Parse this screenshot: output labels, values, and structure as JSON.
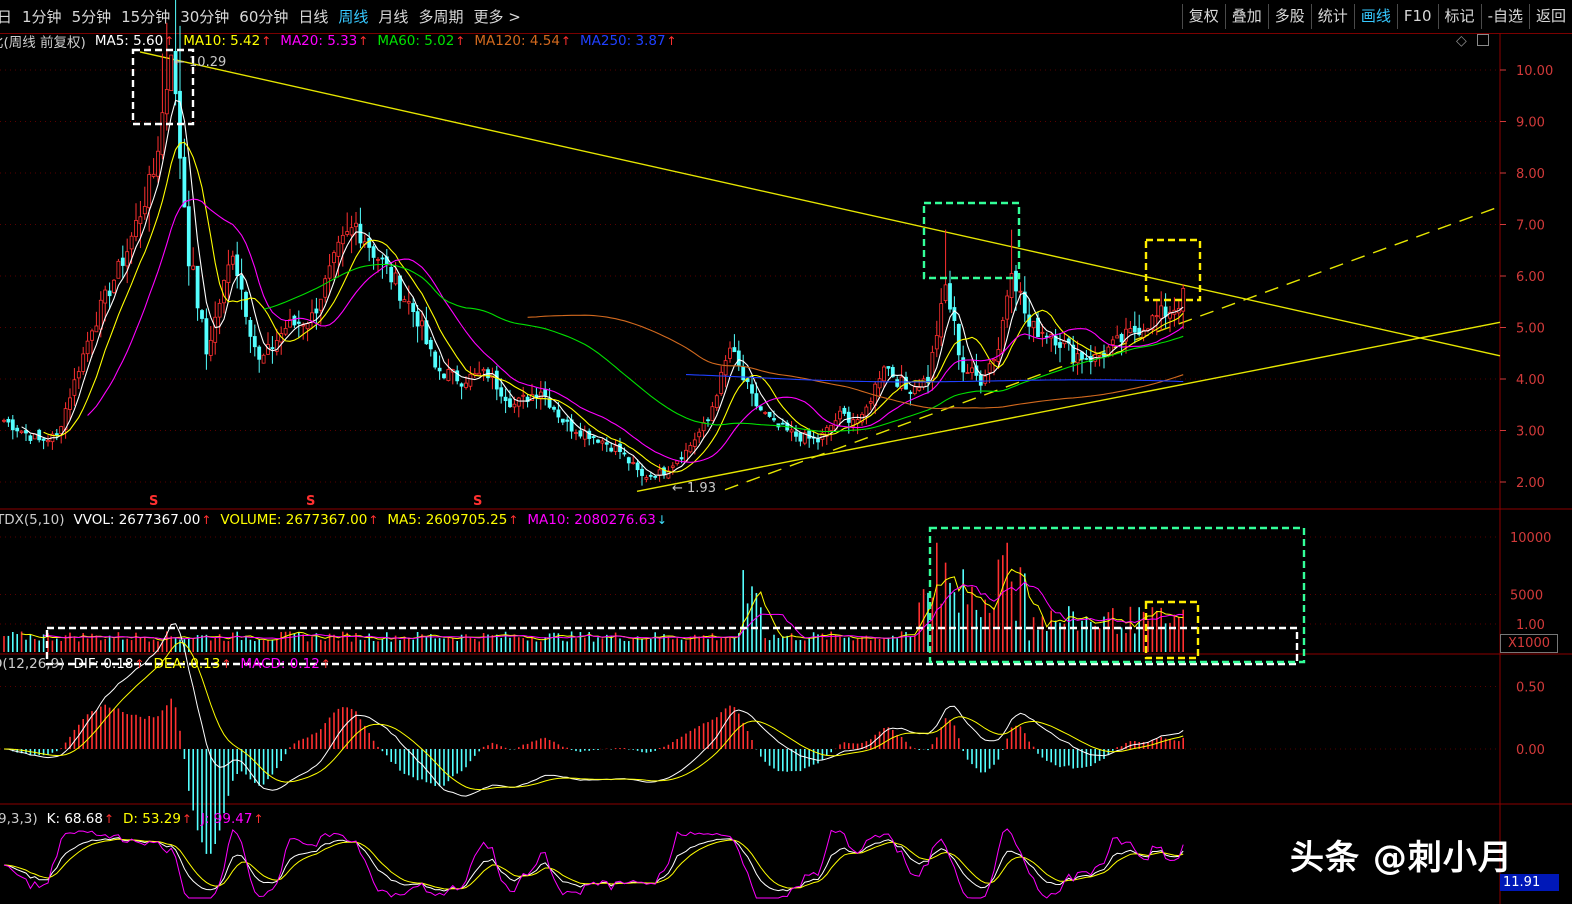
{
  "toolbar": {
    "left_items": [
      {
        "label": "日",
        "active": false
      },
      {
        "label": "1分钟",
        "active": false
      },
      {
        "label": "5分钟",
        "active": false
      },
      {
        "label": "15分钟",
        "active": false
      },
      {
        "label": "30分钟",
        "active": false
      },
      {
        "label": "60分钟",
        "active": false
      },
      {
        "label": "日线",
        "active": false
      },
      {
        "label": "周线",
        "active": true
      },
      {
        "label": "月线",
        "active": false
      },
      {
        "label": "多周期",
        "active": false
      },
      {
        "label": "更多 >",
        "active": false
      }
    ],
    "right_items": [
      {
        "label": "复权",
        "active": false
      },
      {
        "label": "叠加",
        "active": false
      },
      {
        "label": "多股",
        "active": false
      },
      {
        "label": "统计",
        "active": false
      },
      {
        "label": "画线",
        "active": true
      },
      {
        "label": "F10",
        "active": false
      },
      {
        "label": "标记",
        "active": false
      },
      {
        "label": "-自选",
        "active": false
      },
      {
        "label": "返回",
        "active": false
      }
    ]
  },
  "price_legend": {
    "title": "比(周线 前复权)",
    "items": [
      {
        "label": "MA5: 5.60",
        "color": "#ffffff",
        "arrow": "↑",
        "arrow_color": "#ff3030"
      },
      {
        "label": "MA10: 5.42",
        "color": "#ffff00",
        "arrow": "↑",
        "arrow_color": "#ff3030"
      },
      {
        "label": "MA20: 5.33",
        "color": "#ff00ff",
        "arrow": "↑",
        "arrow_color": "#ff3030"
      },
      {
        "label": "MA60: 5.02",
        "color": "#00e000",
        "arrow": "↑",
        "arrow_color": "#ff3030"
      },
      {
        "label": "MA120: 4.54",
        "color": "#d2691e",
        "arrow": "↑",
        "arrow_color": "#ff3030"
      },
      {
        "label": "MA250: 3.87",
        "color": "#2040ff",
        "arrow": "↑",
        "arrow_color": "#ff3030"
      }
    ]
  },
  "volume_legend": {
    "items": [
      {
        "label": "TDX(5,10)",
        "color": "#cccccc",
        "arrow": "",
        "arrow_color": ""
      },
      {
        "label": "VVOL: 2677367.00",
        "color": "#ffffff",
        "arrow": "↑",
        "arrow_color": "#ff3030"
      },
      {
        "label": "VOLUME: 2677367.00",
        "color": "#ffff00",
        "arrow": "↑",
        "arrow_color": "#ff3030"
      },
      {
        "label": "MA5: 2609705.25",
        "color": "#ffff00",
        "arrow": "↑",
        "arrow_color": "#ff3030"
      },
      {
        "label": "MA10: 2080276.63",
        "color": "#ff00ff",
        "arrow": "↓",
        "arrow_color": "#40e0ff"
      }
    ]
  },
  "macd_legend": {
    "items": [
      {
        "label": "D(12,26,9)",
        "color": "#cccccc",
        "arrow": "",
        "arrow_color": ""
      },
      {
        "label": "DIF: 0.18",
        "color": "#ffffff",
        "arrow": "↑",
        "arrow_color": "#ff3030"
      },
      {
        "label": "DEA: 0.13",
        "color": "#ffff00",
        "arrow": "↑",
        "arrow_color": "#ff3030"
      },
      {
        "label": "MACD: 0.12",
        "color": "#ff00ff",
        "arrow": "↑",
        "arrow_color": "#ff3030"
      }
    ]
  },
  "kdj_legend": {
    "items": [
      {
        "label": "9,3,3)",
        "color": "#cccccc",
        "arrow": "",
        "arrow_color": ""
      },
      {
        "label": "K: 68.68",
        "color": "#ffffff",
        "arrow": "↑",
        "arrow_color": "#ff3030"
      },
      {
        "label": "D: 53.29",
        "color": "#ffff00",
        "arrow": "↑",
        "arrow_color": "#ff3030"
      },
      {
        "label": "J: 99.47",
        "color": "#ff00ff",
        "arrow": "↑",
        "arrow_color": "#ff3030"
      }
    ]
  },
  "price_axis": [
    "10.00",
    "9.00",
    "8.00",
    "7.00",
    "6.00",
    "5.00",
    "4.00",
    "3.00",
    "2.00"
  ],
  "volume_axis": [
    "10000",
    "5000"
  ],
  "volume_unit": "X1000",
  "macd_axis": [
    "1.00",
    "0.50",
    "0.00"
  ],
  "kdj_value_box": "11.91",
  "annotations": {
    "high_label": "10.29",
    "low_label": "1.93",
    "dividend_marker": "S"
  },
  "watermark": "头条 @刺小月",
  "colors": {
    "up": "#ff3030",
    "down": "#54ffff",
    "axis_red": "#d23a3a",
    "trendline": "#e6e600",
    "box_white": "#ffffff",
    "box_green": "#33ff99",
    "box_yellow": "#ffee00"
  },
  "chart_data": {
    "type": "candlestick",
    "series_price": {
      "price_range": [
        1.93,
        10.29
      ],
      "ylim": [
        1.8,
        10.5
      ],
      "close_keypoints": [
        [
          0,
          3.2
        ],
        [
          8,
          2.8
        ],
        [
          12,
          2.9
        ],
        [
          20,
          5.0
        ],
        [
          28,
          6.5
        ],
        [
          34,
          8.0
        ],
        [
          38,
          10.29
        ],
        [
          42,
          6.5
        ],
        [
          46,
          4.5
        ],
        [
          52,
          6.5
        ],
        [
          58,
          4.3
        ],
        [
          64,
          5.0
        ],
        [
          70,
          5.2
        ],
        [
          76,
          6.5
        ],
        [
          80,
          7.0
        ],
        [
          88,
          6.0
        ],
        [
          94,
          5.2
        ],
        [
          98,
          4.2
        ],
        [
          104,
          4.0
        ],
        [
          110,
          4.1
        ],
        [
          116,
          3.5
        ],
        [
          122,
          3.8
        ],
        [
          128,
          3.1
        ],
        [
          134,
          2.9
        ],
        [
          140,
          2.6
        ],
        [
          145,
          2.1
        ],
        [
          150,
          2.2
        ],
        [
          155,
          2.6
        ],
        [
          160,
          3.2
        ],
        [
          165,
          4.6
        ],
        [
          170,
          3.6
        ],
        [
          175,
          3.1
        ],
        [
          180,
          2.9
        ],
        [
          185,
          2.8
        ],
        [
          190,
          3.3
        ],
        [
          195,
          3.2
        ],
        [
          200,
          4.3
        ],
        [
          205,
          3.8
        ],
        [
          210,
          4.0
        ],
        [
          214,
          5.8
        ],
        [
          218,
          4.2
        ],
        [
          222,
          4.0
        ],
        [
          226,
          4.6
        ],
        [
          229,
          6.2
        ],
        [
          233,
          5.0
        ],
        [
          238,
          4.9
        ],
        [
          243,
          4.5
        ],
        [
          248,
          4.4
        ],
        [
          253,
          4.7
        ],
        [
          258,
          5.0
        ],
        [
          262,
          5.2
        ],
        [
          266,
          5.4
        ],
        [
          268,
          5.6
        ]
      ]
    },
    "series_volume": {
      "ylim": [
        0,
        12000
      ],
      "ma5": 2609705.25,
      "ma10": 2080276.63
    },
    "series_macd": {
      "ylim": [
        -0.9,
        1.15
      ],
      "dif": 0.18,
      "dea": 0.13,
      "macd": 0.12
    },
    "series_kdj": {
      "k": 68.68,
      "d": 53.29,
      "j": 99.47
    }
  }
}
